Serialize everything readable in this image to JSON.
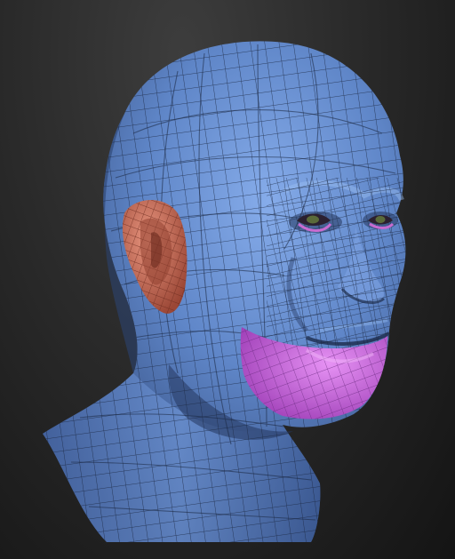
{
  "scene": {
    "subject": "head-model-wireframe",
    "colors": {
      "background": "#262626",
      "skin": "#5a7fc0",
      "skin_light": "#7da3df",
      "skin_shadow": "#2e4572",
      "wire": "#1a2740",
      "ear": "#d8765f",
      "ear_shadow": "#8f3f30",
      "chin": "#c25ad8",
      "chin_light": "#e08af0",
      "eye_lid": "#c86bd0"
    }
  }
}
